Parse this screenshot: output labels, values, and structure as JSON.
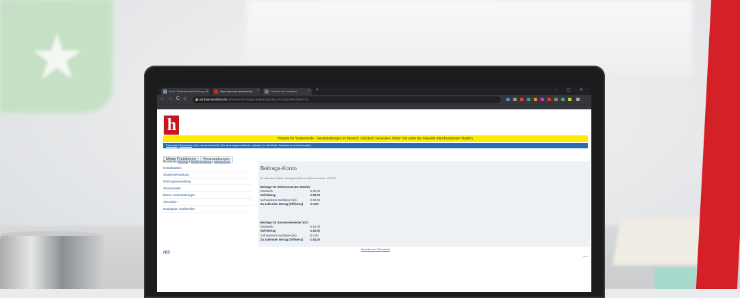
{
  "browser": {
    "tabs": [
      {
        "label": "Kurs: Studentenwerk Beitrag zur"
      },
      {
        "label": "https://qis.haw-landshut.de"
      },
      {
        "label": "Hochschule Landshut"
      }
    ],
    "new_tab": "+",
    "window_controls": "– ▢ ✕",
    "back": "←",
    "forward": "→",
    "reload": "C",
    "home": "⌂",
    "url_host": "qis.haw-landshut.de",
    "url_path": "/qisserver/rds?state=gebkonto&sfsa=rKb2Q&sd9eJb9gr7G1"
  },
  "page": {
    "logo_mark": "h",
    "notice": "Hinweis für Studierende - Veranstaltungen im Bereich »Studium Generale« finden Sie unter der Fakultät Interdisziplinäre Studien.",
    "status_bar": {
      "startseite": "Startseite",
      "abmelden": "Abmelden",
      "sep": "|",
      "user": "Herr Jonas Laukardt",
      "logged_as": "Sie sind angemeldet als: s.jlauka",
      "role": "in der Rolle: Student/-in der Informatik"
    },
    "function_tabs": [
      "Meine Funktionen",
      "Veranstaltungen"
    ],
    "breadcrumb": {
      "prefix": "Sie sind hier:",
      "items": [
        "Startseite",
        "Studienverwaltung",
        "Beitrags-Konto"
      ],
      "arrow": "▸"
    },
    "sidebar": [
      "Kontaktdaten",
      "Studienverwaltung",
      "Prüfungsverwaltung",
      "Stundenplan",
      "Meine Veranstaltungen",
      "Abmelden",
      "Navigation ausblenden"
    ],
    "content": {
      "title": "Beitrags-Konto",
      "status": "Ihr aktueller Status: Rückgemeldet im Wintersemester 2020/21",
      "semesters": [
        {
          "heading": "Beiträge für Wintersemester 2020/21",
          "rows": [
            {
              "label": "Studiwerk",
              "value": "€ 82,00",
              "bold": false
            },
            {
              "label": "Soll-Betrag",
              "value": "€ 82,00",
              "bold": true
            },
            {
              "label": "Vorhandenes Guthaben (Ist)",
              "value": "€ 82,00",
              "bold": false
            },
            {
              "label": "Zu zahlender Betrag (Differenz)",
              "value": "€   0,00",
              "bold": true
            }
          ]
        },
        {
          "heading": "Beiträge für Sommersemester 2021",
          "rows": [
            {
              "label": "Studiwerk",
              "value": "€ 82,00",
              "bold": false
            },
            {
              "label": "Soll-Betrag",
              "value": "€ 82,00",
              "bold": true
            },
            {
              "label": "Vorhandenes Guthaben (Ist)",
              "value": "€   0,00",
              "bold": false
            },
            {
              "label": "Zu zahlender Betrag (Differenz)",
              "value": "€ 82,00",
              "bold": true
            }
          ]
        }
      ]
    },
    "footer_link": "Hinweise zum Datenschutz",
    "his_logo": "HIS",
    "version": "qisv1"
  },
  "colors": {
    "notice_bg": "#ffec00",
    "statusbar_bg": "#2a6db0",
    "logo_red": "#c4171f",
    "accent_stripe": "#d42127"
  }
}
